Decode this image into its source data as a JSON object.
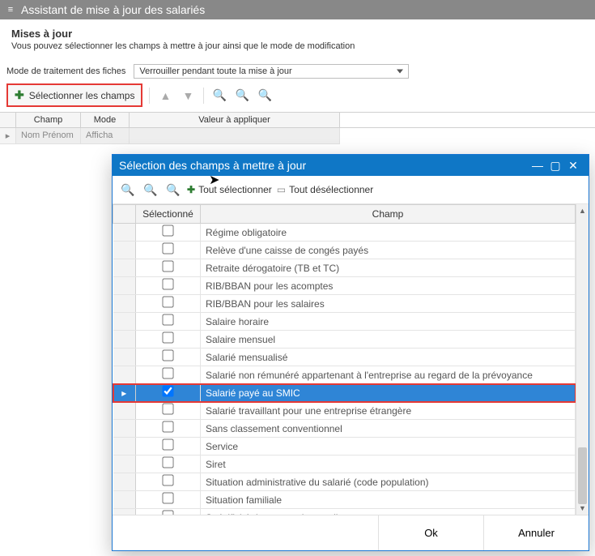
{
  "titlebar": {
    "title": "Assistant de mise à jour des salariés"
  },
  "section": {
    "heading": "Mises à jour",
    "sub": "Vous pouvez sélectionner les champs à mettre à jour ainsi que le mode de modification"
  },
  "mode_row": {
    "label": "Mode de traitement des fiches",
    "value": "Verrouiller pendant toute la mise à jour"
  },
  "toolbar": {
    "select_fields": "Sélectionner les champs"
  },
  "main_grid": {
    "headers": {
      "champ": "Champ",
      "mode": "Mode",
      "valeur": "Valeur à appliquer"
    },
    "row": {
      "champ": "Nom Prénom",
      "mode": "Afficha"
    }
  },
  "modal": {
    "title": "Sélection des champs à mettre à jour",
    "toolbar": {
      "select_all": "Tout sélectionner",
      "deselect_all": "Tout désélectionner"
    },
    "headers": {
      "selected": "Sélectionné",
      "champ": "Champ"
    },
    "rows": [
      {
        "checked": false,
        "label": "Régime obligatoire"
      },
      {
        "checked": false,
        "label": "Relève d'une caisse de congés payés"
      },
      {
        "checked": false,
        "label": "Retraite dérogatoire (TB et TC)"
      },
      {
        "checked": false,
        "label": "RIB/BBAN pour les acomptes"
      },
      {
        "checked": false,
        "label": "RIB/BBAN pour les salaires"
      },
      {
        "checked": false,
        "label": "Salaire horaire"
      },
      {
        "checked": false,
        "label": "Salaire mensuel"
      },
      {
        "checked": false,
        "label": "Salarié mensualisé"
      },
      {
        "checked": false,
        "label": "Salarié non rémunéré appartenant à l'entreprise au regard de la prévoyance"
      },
      {
        "checked": true,
        "label": "Salarié payé au SMIC",
        "selected": true
      },
      {
        "checked": false,
        "label": "Salarié travaillant pour une entreprise étrangère"
      },
      {
        "checked": false,
        "label": "Sans classement conventionnel"
      },
      {
        "checked": false,
        "label": "Service"
      },
      {
        "checked": false,
        "label": "Siret"
      },
      {
        "checked": false,
        "label": "Situation administrative du salarié (code population)"
      },
      {
        "checked": false,
        "label": "Situation familiale"
      },
      {
        "checked": false,
        "label": "Spécificité du contrat de travail"
      }
    ],
    "buttons": {
      "ok": "Ok",
      "cancel": "Annuler"
    }
  }
}
